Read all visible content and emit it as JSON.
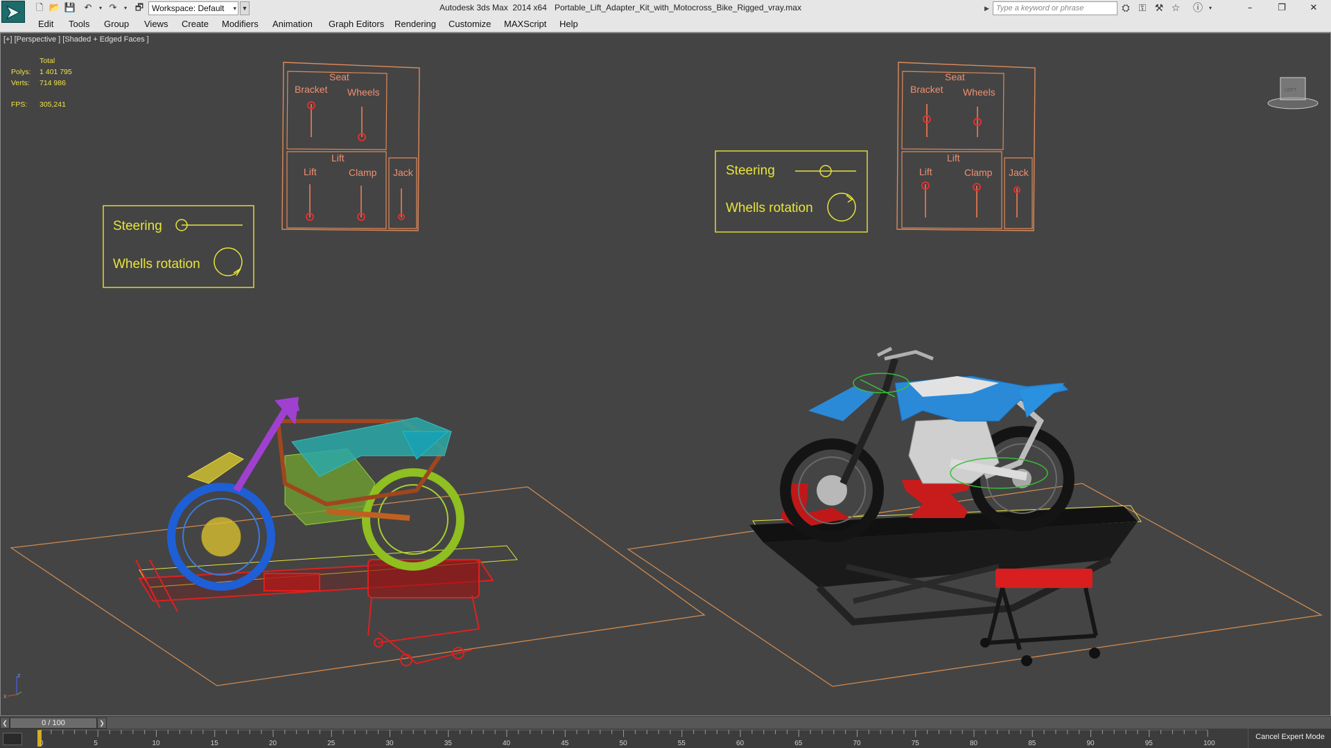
{
  "window": {
    "app_title": "Autodesk 3ds Max  2014 x64",
    "file_name": "Portable_Lift_Adapter_Kit_with_Motocross_Bike_Rigged_vray.max",
    "workspace_label": "Workspace: Default",
    "search_placeholder": "Type a keyword or phrase"
  },
  "menu": [
    "Edit",
    "Tools",
    "Group",
    "Views",
    "Create",
    "Modifiers",
    "Animation",
    "Graph Editors",
    "Rendering",
    "Customize",
    "MAXScript",
    "Help"
  ],
  "viewport": {
    "label": "[+] [Perspective ] [Shaded + Edged Faces ]",
    "stats": {
      "total_label": "Total",
      "polys_label": "Polys:",
      "polys_value": "1 401 795",
      "verts_label": "Verts:",
      "verts_value": "714 986",
      "fps_label": "FPS:",
      "fps_value": "305,241"
    },
    "viewcube_label": "LEFT",
    "rig_left": {
      "title_seat": "Seat",
      "bracket": "Bracket",
      "wheels": "Wheels",
      "title_lift": "Lift",
      "lift": "Lift",
      "clamp": "Clamp",
      "jack": "Jack"
    },
    "rig_right": {
      "title_seat": "Seat",
      "bracket": "Bracket",
      "wheels": "Wheels",
      "title_lift": "Lift",
      "lift": "Lift",
      "clamp": "Clamp",
      "jack": "Jack"
    },
    "steer_left": {
      "steering": "Steering",
      "rotation": "Whells rotation"
    },
    "steer_right": {
      "steering": "Steering",
      "rotation": "Whells rotation"
    },
    "axis": {
      "z": "z",
      "x": "x"
    }
  },
  "timeline": {
    "frame_display": "0 / 100",
    "current_frame": 0,
    "ticks": [
      0,
      5,
      10,
      15,
      20,
      25,
      30,
      35,
      40,
      45,
      50,
      55,
      60,
      65,
      70,
      75,
      80,
      85,
      90,
      95,
      100
    ],
    "cancel_expert": "Cancel Expert Mode"
  },
  "colors": {
    "rig_line": "#e08a5a",
    "rig_text": "#f09070",
    "steer_line": "#e7e53b",
    "stats_text": "#f2e24a",
    "bike_blue": "#1e88d6",
    "lift_red": "#e02020",
    "ground_line": "#d08a50"
  }
}
